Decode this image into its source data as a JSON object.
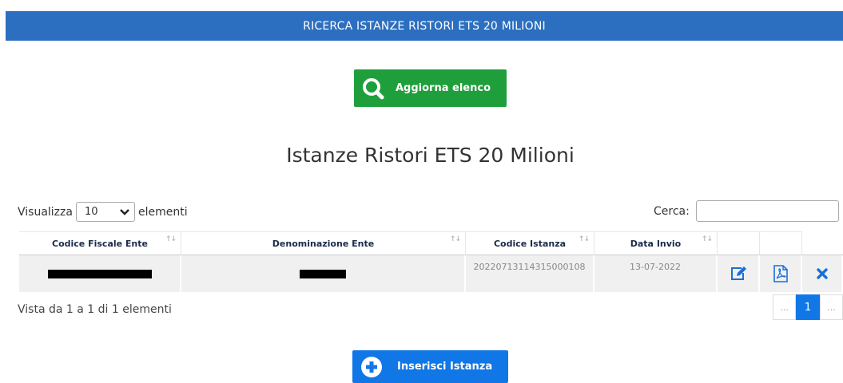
{
  "header": {
    "title": "RICERCA ISTANZE RISTORI ETS 20 MILIONI"
  },
  "actions": {
    "refresh_label": "Aggiorna elenco",
    "insert_label": "Inserisci Istanza"
  },
  "page": {
    "title": "Istanze Ristori ETS 20 Milioni"
  },
  "table_controls": {
    "show_label": "Visualizza",
    "page_length": "10",
    "elements_label": "elementi",
    "search_label": "Cerca:",
    "search_value": ""
  },
  "table": {
    "columns": [
      "Codice Fiscale Ente",
      "Denominazione Ente",
      "Codice Istanza",
      "Data Invio"
    ],
    "rows": [
      {
        "codice_istanza": "20220713114315000108",
        "data_invio": "13-07-2022"
      }
    ]
  },
  "footer": {
    "info": "Vista da 1 a 1 di 1 elementi"
  },
  "pagination": {
    "prev": "...",
    "current": "1",
    "next": "..."
  },
  "icons": [
    "search-icon",
    "edit-icon",
    "pdf-icon",
    "delete-icon",
    "add-circle-icon",
    "chevron-down-icon",
    "sort-icon"
  ],
  "colors": {
    "header_bg": "#2c6fc0",
    "refresh_button": "#1f9f3b",
    "primary": "#1177e6"
  }
}
